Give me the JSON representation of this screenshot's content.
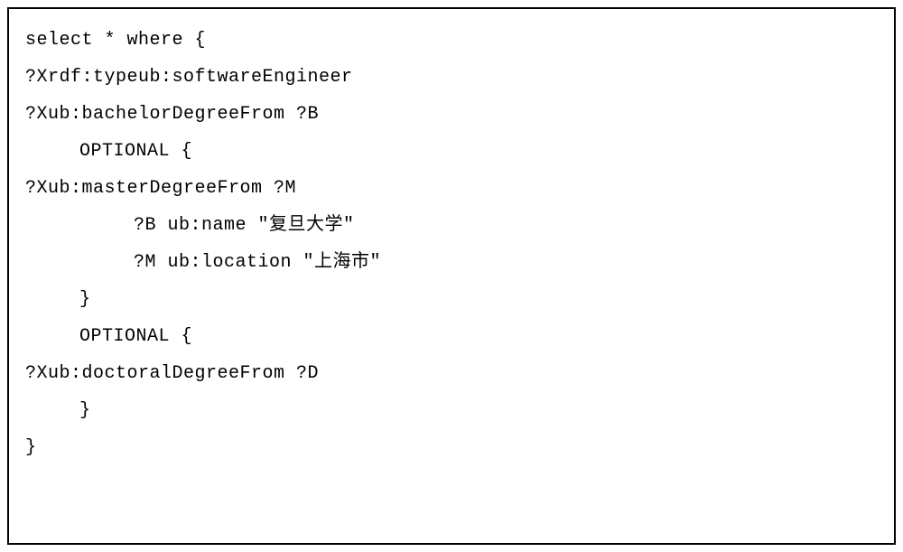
{
  "code": {
    "lines": [
      {
        "text": "select * where {",
        "indent": 0
      },
      {
        "text": "?Xrdf:typeub:softwareEngineer",
        "indent": 0
      },
      {
        "text": "?Xub:bachelorDegreeFrom ?B",
        "indent": 0
      },
      {
        "text": "OPTIONAL {",
        "indent": 1
      },
      {
        "text": "?Xub:masterDegreeFrom ?M",
        "indent": 0
      },
      {
        "text": "?B ub:name \"复旦大学\"",
        "indent": 2
      },
      {
        "text": "?M ub:location \"上海市\"",
        "indent": 2
      },
      {
        "text": "}",
        "indent": 1
      },
      {
        "text": "OPTIONAL {",
        "indent": 1
      },
      {
        "text": "?Xub:doctoralDegreeFrom ?D",
        "indent": 0
      },
      {
        "text": "}",
        "indent": 1
      },
      {
        "text": "}",
        "indent": 0
      }
    ]
  }
}
